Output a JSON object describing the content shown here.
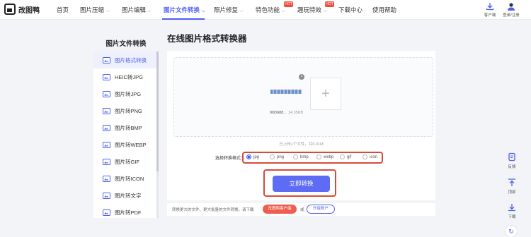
{
  "brand": {
    "name": "改图鸭"
  },
  "nav": {
    "items": [
      {
        "label": "首页",
        "dropdown": false
      },
      {
        "label": "图片压缩",
        "dropdown": true
      },
      {
        "label": "图片编辑",
        "dropdown": true
      },
      {
        "label": "图片文件转换",
        "dropdown": true,
        "active": true
      },
      {
        "label": "照片修复",
        "dropdown": true
      },
      {
        "label": "特色功能",
        "dropdown": true,
        "badge": "HOT"
      },
      {
        "label": "趣玩特效",
        "dropdown": true,
        "badge": "HOT"
      },
      {
        "label": "下载中心",
        "dropdown": false
      },
      {
        "label": "使用帮助",
        "dropdown": false
      }
    ],
    "client_label": "客户端",
    "login_label": "登录/注册"
  },
  "sidebar": {
    "title": "图片文件转换",
    "items": [
      {
        "label": "图片格式转换",
        "active": true
      },
      {
        "label": "HEIC转JPG"
      },
      {
        "label": "图片转JPG"
      },
      {
        "label": "图片转PNG"
      },
      {
        "label": "图片转BMP"
      },
      {
        "label": "图片转WEBP"
      },
      {
        "label": "图片转GIF"
      },
      {
        "label": "图片转ICON"
      },
      {
        "label": "图片转文字"
      },
      {
        "label": "图片转PDF"
      }
    ]
  },
  "main": {
    "title": "在线图片格式转换器",
    "file": {
      "name": "90D688...",
      "size": "14.35KB",
      "remove": "×"
    },
    "add_symbol": "+",
    "upload_info": "已上传1个文件，共0.01M",
    "format_label": "选择转换格式：",
    "formats": [
      "jpg",
      "png",
      "bmp",
      "webp",
      "gif",
      "icon"
    ],
    "selected_format": "jpg",
    "convert_button": "立即转换",
    "bottom_note": "转换更大的文件、更大批量的文件转换，请下载",
    "client_button": "改图鸭客户端",
    "or_text": "或",
    "upgrade_button": "升级账户"
  },
  "float_tools": [
    {
      "label": "反馈"
    },
    {
      "label": "顶部"
    },
    {
      "label": "下载"
    }
  ],
  "colors": {
    "accent": "#4d5ff2",
    "highlight": "#d94a38",
    "hot": "#f04b3d"
  }
}
